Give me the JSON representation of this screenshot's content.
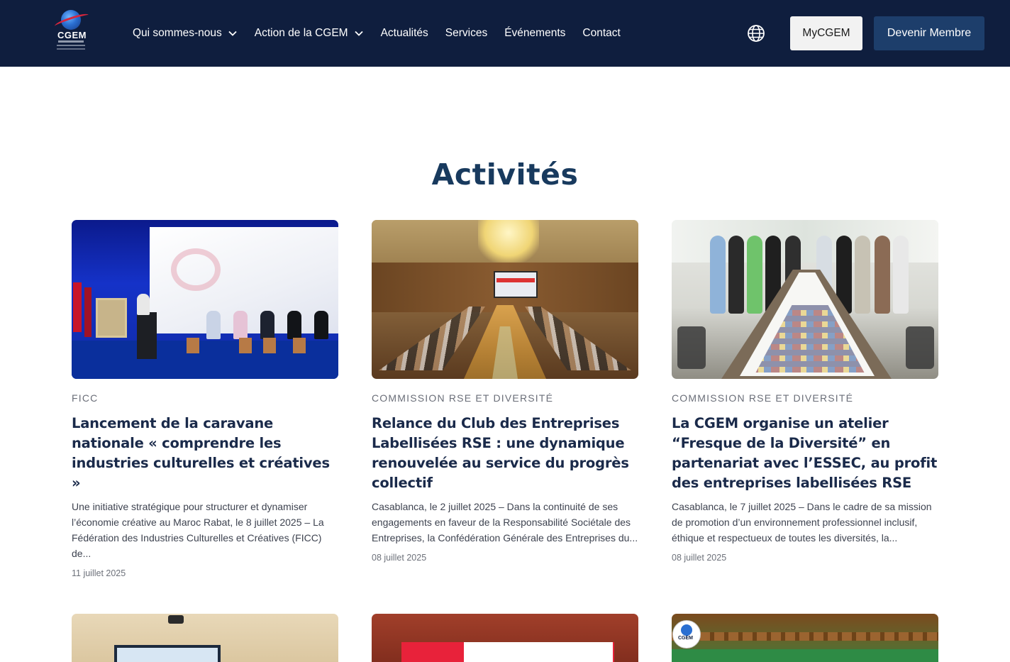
{
  "header": {
    "logo_text": "CGEM",
    "nav": [
      {
        "label": "Qui sommes-nous",
        "has_dropdown": true
      },
      {
        "label": "Action de la CGEM",
        "has_dropdown": true
      },
      {
        "label": "Actualités",
        "has_dropdown": false
      },
      {
        "label": "Services",
        "has_dropdown": false
      },
      {
        "label": "Événements",
        "has_dropdown": false
      },
      {
        "label": "Contact",
        "has_dropdown": false
      }
    ],
    "language_icon": "globe-icon",
    "mycgem_label": "MyCGEM",
    "member_label": "Devenir Membre"
  },
  "main": {
    "title": "Activités",
    "cards": [
      {
        "category": "FICC",
        "title": "Lancement de la caravane nationale « comprendre les industries culturelles et créatives »",
        "excerpt": "Une initiative stratégique pour structurer et dynamiser l’économie créative au Maroc Rabat, le 8 juillet 2025 – La Fédération des Industries Culturelles et Créatives (FICC) de...",
        "date": "11 juillet 2025"
      },
      {
        "category": "COMMISSION RSE ET DIVERSITÉ",
        "title": "Relance du Club des Entreprises Labellisées RSE : une dynamique renouvelée au service du progrès collectif",
        "excerpt": "Casablanca, le 2 juillet 2025 – Dans la continuité de ses engagements en faveur de la Responsabilité Sociétale des Entreprises, la Confédération Générale des Entreprises du...",
        "date": "08 juillet 2025"
      },
      {
        "category": "COMMISSION RSE ET DIVERSITÉ",
        "title": "La CGEM organise un atelier “Fresque de la Diversité” en partenariat avec l’ESSEC, au profit des entreprises labellisées RSE",
        "excerpt": "Casablanca, le 7 juillet 2025 – Dans le cadre de sa mission de promotion d’un environnement professionnel inclusif, éthique et respectueux de toutes les diversités, la...",
        "date": "08 juillet 2025"
      }
    ],
    "bottom_badge_text": "CGEM"
  },
  "colors": {
    "header_bg": "#0f1e3e",
    "title": "#183a5e",
    "member_button": "#1d3e6b",
    "mycgem_button": "#f2f2f2"
  }
}
